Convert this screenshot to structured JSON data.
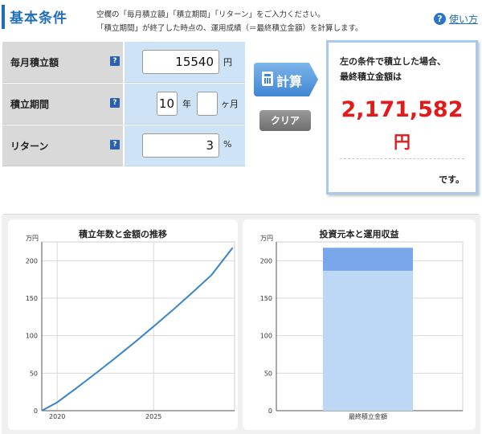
{
  "header": {
    "title": "基本条件",
    "desc_line1": "空欄の「毎月積立額」「積立期間」「リターン」をご入力ください。",
    "desc_line2": "「積立期間」が終了した時点の、運用成績（＝最終積立金額）を計算します。",
    "help_label": "使い方"
  },
  "form": {
    "monthly": {
      "label": "毎月積立額",
      "value": "15540",
      "unit": "円"
    },
    "period": {
      "label": "積立期間",
      "years": "10",
      "years_unit": "年",
      "months": "",
      "months_unit": "ヶ月"
    },
    "return": {
      "label": "リターン",
      "value": "3",
      "unit": "%"
    },
    "help_icon": "?"
  },
  "buttons": {
    "calc": "計算",
    "clear": "クリア"
  },
  "result": {
    "line1": "左の条件で積立した場合、",
    "line2": "最終積立金額は",
    "amount": "2,171,582",
    "yen": "円",
    "suffix": "です。"
  },
  "colors": {
    "accent": "#1e6fb8",
    "result_red": "#e41a1a",
    "line": "#3a86c8",
    "bar_principal": "#bcd8f4",
    "bar_profit": "#7aa7ec"
  },
  "chart_data": [
    {
      "type": "line",
      "title": "積立年数と金額の推移",
      "unit": "万円",
      "ylim": [
        0,
        225
      ],
      "yticks": [
        0,
        50,
        100,
        150,
        200
      ],
      "xticks": [
        "2020",
        "2025"
      ],
      "x": [
        2019.2,
        2020,
        2021,
        2022,
        2023,
        2024,
        2025,
        2026,
        2027,
        2028,
        2029.1
      ],
      "series": [
        {
          "values": [
            0,
            11.1,
            30.2,
            49.8,
            70.0,
            90.8,
            112.3,
            134.4,
            157.2,
            180.7,
            217.2
          ]
        }
      ]
    },
    {
      "type": "bar",
      "title": "投資元本と運用収益",
      "unit": "万円",
      "ylim": [
        0,
        225
      ],
      "yticks": [
        0,
        50,
        100,
        150,
        200
      ],
      "categories": [
        "最終積立金額"
      ],
      "series": [
        {
          "values": [
            186.5
          ]
        },
        {
          "values": [
            30.7
          ]
        }
      ]
    }
  ]
}
